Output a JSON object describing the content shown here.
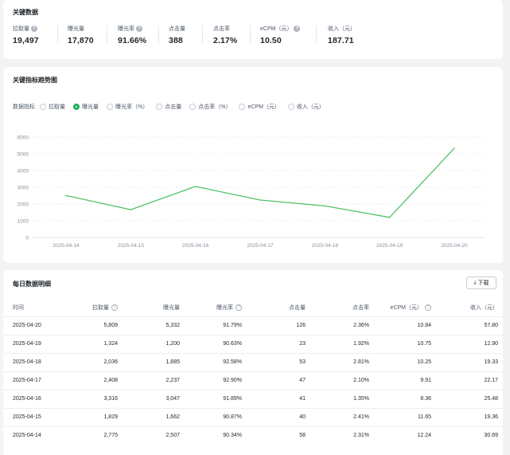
{
  "key_metrics": {
    "title": "关键数据",
    "items": [
      {
        "label": "拉取量",
        "value": "19,497",
        "help": true
      },
      {
        "label": "曝光量",
        "value": "17,870",
        "help": false
      },
      {
        "label": "曝光率",
        "value": "91.66%",
        "help": true
      },
      {
        "label": "点击量",
        "value": "388",
        "help": false
      },
      {
        "label": "点击率",
        "value": "2.17%",
        "help": false
      },
      {
        "label": "eCPM（元）",
        "value": "10.50",
        "help": true
      },
      {
        "label": "收入（元）",
        "value": "187.71",
        "help": false
      }
    ]
  },
  "trend": {
    "title": "关键指标趋势图",
    "filter_label": "数据指标",
    "options": [
      "拉取量",
      "曝光量",
      "曝光率（%）",
      "点击量",
      "点击率（%）",
      "eCPM（元）",
      "收入（元）"
    ],
    "selected": 1
  },
  "chart_data": {
    "type": "line",
    "x": [
      "2025-04-14",
      "2025-04-15",
      "2025-04-16",
      "2025-04-17",
      "2025-04-18",
      "2025-04-19",
      "2025-04-20"
    ],
    "series": [
      {
        "name": "曝光量",
        "values": [
          2507,
          1662,
          3047,
          2237,
          1885,
          1200,
          5332
        ]
      }
    ],
    "yticks": [
      "0",
      "1000",
      "2000",
      "3000",
      "4000",
      "5000",
      "6000"
    ],
    "ylim": [
      0,
      6000
    ],
    "grid": true,
    "line_color": "#52c26a"
  },
  "daily_table": {
    "title": "每日数据明细",
    "download_label": "下载",
    "columns": [
      {
        "label": "时间",
        "help": false
      },
      {
        "label": "拉取量",
        "help": true
      },
      {
        "label": "曝光量",
        "help": false
      },
      {
        "label": "曝光率",
        "help": true
      },
      {
        "label": "点击量",
        "help": false
      },
      {
        "label": "点击率",
        "help": false
      },
      {
        "label": "eCPM（元）",
        "help": true
      },
      {
        "label": "收入（元）",
        "help": false
      }
    ],
    "rows": [
      [
        "2025-04-20",
        "5,809",
        "5,332",
        "91.79%",
        "126",
        "2.36%",
        "10.84",
        "57.80"
      ],
      [
        "2025-04-19",
        "1,324",
        "1,200",
        "90.63%",
        "23",
        "1.92%",
        "10.75",
        "12.90"
      ],
      [
        "2025-04-18",
        "2,036",
        "1,885",
        "92.58%",
        "53",
        "2.81%",
        "10.25",
        "19.33"
      ],
      [
        "2025-04-17",
        "2,408",
        "2,237",
        "92.90%",
        "47",
        "2.10%",
        "9.91",
        "22.17"
      ],
      [
        "2025-04-16",
        "3,316",
        "3,047",
        "91.89%",
        "41",
        "1.35%",
        "8.36",
        "25.48"
      ],
      [
        "2025-04-15",
        "1,829",
        "1,662",
        "90.87%",
        "40",
        "2.41%",
        "11.65",
        "19.36"
      ],
      [
        "2025-04-14",
        "2,775",
        "2,507",
        "90.34%",
        "58",
        "2.31%",
        "12.24",
        "30.69"
      ]
    ]
  }
}
